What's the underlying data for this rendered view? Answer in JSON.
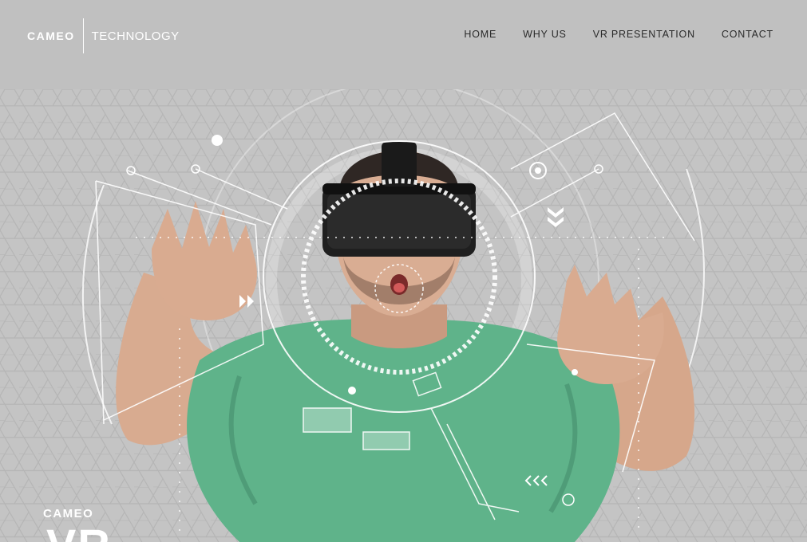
{
  "brand": {
    "name": "CAMEO",
    "tagline": "TECHNOLOGY"
  },
  "nav": {
    "items": [
      "HOME",
      "WHY US",
      "VR PRESENTATION",
      "CONTACT"
    ]
  },
  "hero": {
    "brand": "CAMEO",
    "title": "VR",
    "image_icon": "vr-headset-man-hud-image"
  },
  "colors": {
    "background": "#c0c0c0",
    "shirt": "#5fb38a",
    "headset": "#1f1f1f",
    "skin": "#d4a58a"
  }
}
